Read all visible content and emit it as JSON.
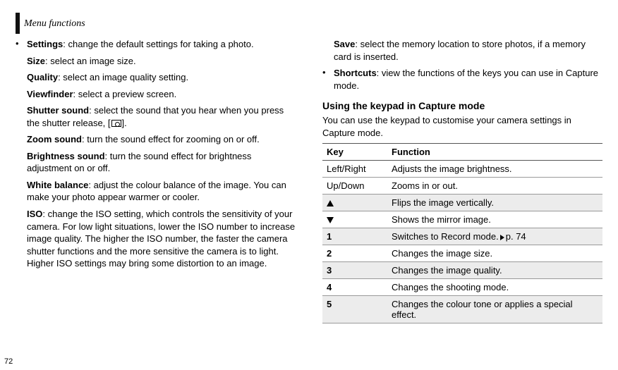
{
  "header": {
    "title": "Menu functions"
  },
  "page_number": "72",
  "left": {
    "settings": {
      "label": "Settings",
      "desc": ": change the default settings for taking a photo.",
      "items": [
        {
          "name": "Size",
          "desc": ": select an image size."
        },
        {
          "name": "Quality",
          "desc": ": select an image quality setting."
        },
        {
          "name": "Viewfinder",
          "desc": ": select a preview screen."
        },
        {
          "name": "Shutter sound",
          "desc": ": select the sound that you hear when you press the shutter release, [",
          "after_icon": "]."
        },
        {
          "name": "Zoom sound",
          "desc": ": turn the sound effect for zooming on or off."
        },
        {
          "name": "Brightness sound",
          "desc": ": turn the sound effect for brightness adjustment on or off."
        },
        {
          "name": "White balance",
          "desc": ": adjust the colour balance of the image. You can make your photo appear warmer or cooler."
        },
        {
          "name": "ISO",
          "desc": ": change the ISO setting, which controls the sensitivity of your camera. For low light situations, lower the ISO number to increase image quality. The higher the ISO number, the faster the camera shutter functions and the more sensitive the camera is to light. Higher ISO settings may bring some distortion to an image."
        }
      ]
    }
  },
  "right": {
    "save": {
      "name": "Save",
      "desc": ": select the memory location to store photos, if a memory card is inserted."
    },
    "shortcuts": {
      "name": "Shortcuts",
      "desc": ": view the functions of the keys you can use in Capture mode."
    },
    "section_title": "Using the keypad in Capture mode",
    "section_intro": "You can use the keypad to customise your camera settings in Capture mode.",
    "table": {
      "head": {
        "c1": "Key",
        "c2": "Function"
      },
      "rows": [
        {
          "key": "Left/Right",
          "fn": "Adjusts the image brightness.",
          "shaded": false
        },
        {
          "key": "Up/Down",
          "fn": "Zooms in or out.",
          "shaded": false
        },
        {
          "key_icon": "up",
          "fn": "Flips the image vertically.",
          "shaded": true
        },
        {
          "key_icon": "down",
          "fn": "Shows the mirror image.",
          "shaded": false
        },
        {
          "key": "1",
          "fn": "Switches to Record mode.",
          "ref": "p. 74",
          "shaded": true
        },
        {
          "key": "2",
          "fn": "Changes the image size.",
          "shaded": false
        },
        {
          "key": "3",
          "fn": "Changes the image quality.",
          "shaded": true
        },
        {
          "key": "4",
          "fn": "Changes the shooting mode.",
          "shaded": false
        },
        {
          "key": "5",
          "fn": "Changes the colour tone or applies a special effect.",
          "shaded": true
        }
      ]
    }
  }
}
